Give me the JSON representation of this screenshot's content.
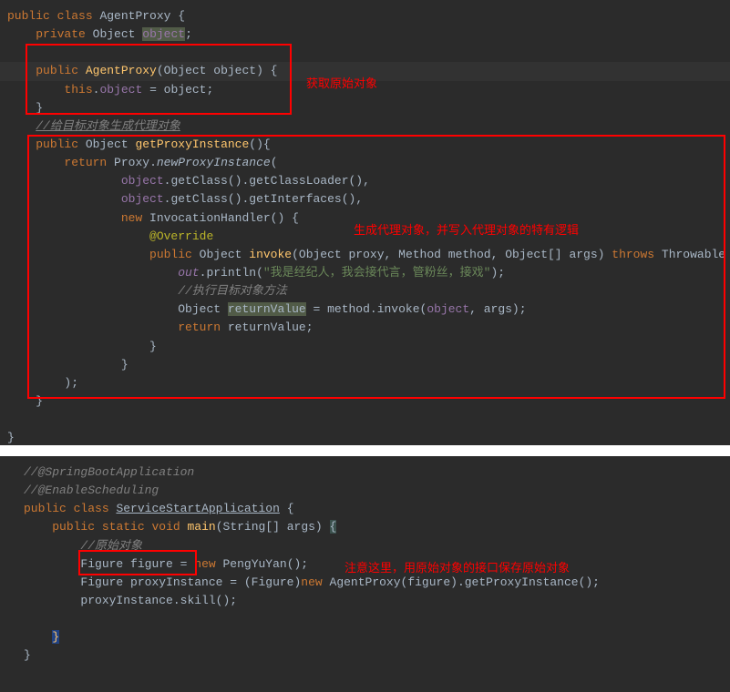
{
  "block1": {
    "tokens": {
      "public": "public",
      "class": "class",
      "AgentProxy": "AgentProxy",
      "lbrace": " {",
      "private": "private",
      "Object": "Object",
      "objectField": "object",
      "semi": ";",
      "AgentProxyCtor": "AgentProxy",
      "ctorParams": "(Object object) {",
      "this": "this",
      "dot": ".",
      "assign": " = object",
      "rbrace": "}",
      "cmt1": "//给目标对象生成代理对象",
      "getProxyInstance": "getProxyInstance",
      "emptyParens": "(){",
      "return": "return",
      "Proxy": "Proxy",
      "newProxyInstance": "newProxyInstance",
      "lparen": "(",
      "getClass": "getClass",
      "getClassLoader": "getClassLoader",
      "getInterfaces": "getInterfaces",
      "comma": ",",
      "new": "new",
      "InvocationHandler": "InvocationHandler",
      "anonBrace": "() {",
      "Override": "@Override",
      "invoke": "invoke",
      "invokeParams1": "(Object proxy",
      "Method": "Method",
      "methodParam": "method",
      "ObjectArr": "Object[]",
      "args": "args",
      "throws": "throws",
      "Throwable": "Throwable",
      "out": "out",
      "println": "println",
      "strLit": "\"我是经纪人，我会接代言，管粉丝，接戏\"",
      "cmt2": "//执行目标对象方法",
      "returnValue": "returnValue",
      "methodInvoke": "method.invoke(",
      "argsEnd": ", args)",
      "returnKw": "return"
    },
    "annotations": {
      "a1": "获取原始对象",
      "a2": "生成代理对象，并写入代理对象的特有逻辑"
    }
  },
  "block2": {
    "tokens": {
      "cmt0": "//@SpringBootApplication",
      "cmt1": "//@EnableScheduling",
      "public": "public",
      "class": "class",
      "ServiceStartApplication": "ServiceStartApplication",
      "lbrace": " {",
      "static": "static",
      "void": "void",
      "main": "main",
      "mainParams": "(String[] args) ",
      "openBrace": "{",
      "cmt2": "//原始对象",
      "Figure": "Figure",
      "figure": "figure",
      "eq": " = ",
      "new": "new",
      "PengYuYan": "PengYuYan",
      "emptyCall": "();",
      "proxyInstance": "proxyInstance",
      "cast": " = (Figure)",
      "AgentProxy": "AgentProxy",
      "figureArg": "(figure).",
      "getProxyInstance": "getProxyInstance",
      "call": "();",
      "skill": "skill",
      "rbrace": "}",
      "closeBrace": "}"
    },
    "annotations": {
      "a1": "注意这里，用原始对象的接口保存原始对象"
    }
  }
}
